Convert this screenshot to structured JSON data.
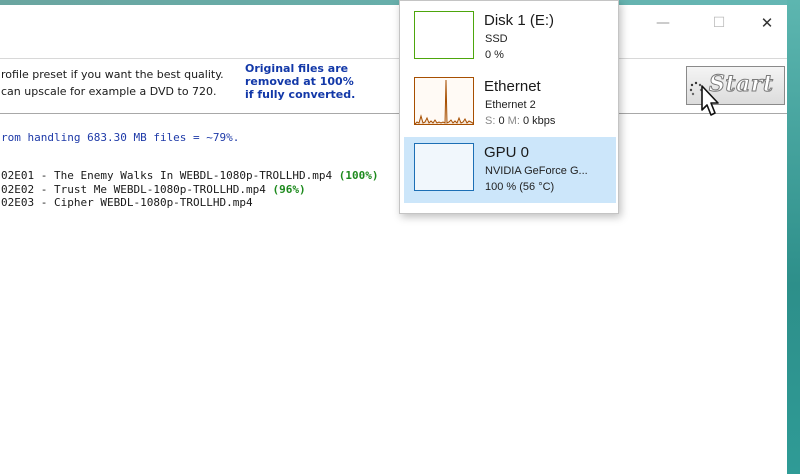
{
  "window": {
    "controls": {
      "minimize": "—",
      "maximize": "☐",
      "close": "✕"
    }
  },
  "infobar": {
    "hint_line1": "rofile preset if you want the best quality.",
    "hint_line2": " can upscale for example a DVD to 720.",
    "notice_line1": "Original files are",
    "notice_line2": "removed at 100%",
    "notice_line3": "if fully converted.",
    "start_button": "Start"
  },
  "status": {
    "text": "rom handling 683.30 MB files = ~79%."
  },
  "files": [
    {
      "name": "02E01 - The Enemy Walks In WEBDL-1080p-TROLLHD.mp4",
      "progress": "(100%)"
    },
    {
      "name": "02E02 - Trust Me WEBDL-1080p-TROLLHD.mp4",
      "progress": "(96%)"
    },
    {
      "name": "02E03 - Cipher WEBDL-1080p-TROLLHD.mp4",
      "progress": ""
    }
  ],
  "performance_panel": {
    "items": [
      {
        "title": "Disk 1 (E:)",
        "subtitle": "SSD",
        "value": "0 %",
        "color": "#4da60c",
        "selected": false
      },
      {
        "title": "Ethernet",
        "subtitle": "Ethernet 2",
        "value_label_s": "S:",
        "value_s": "0",
        "value_label_r": "M:",
        "value_r": "0 kbps",
        "color": "#a74f01",
        "selected": false
      },
      {
        "title": "GPU 0",
        "subtitle": "NVIDIA GeForce G...",
        "value": "100 %  (56 °C)",
        "color": "#1c6fb5",
        "selected": true
      }
    ]
  },
  "colors": {
    "desktop": "#5fb0ad",
    "notice": "#1238a8",
    "progress_done": "#1d8a1d",
    "selection": "#cce6fa"
  },
  "icons": [
    "pointer-cursor-icon",
    "busy-spinner-icon"
  ]
}
